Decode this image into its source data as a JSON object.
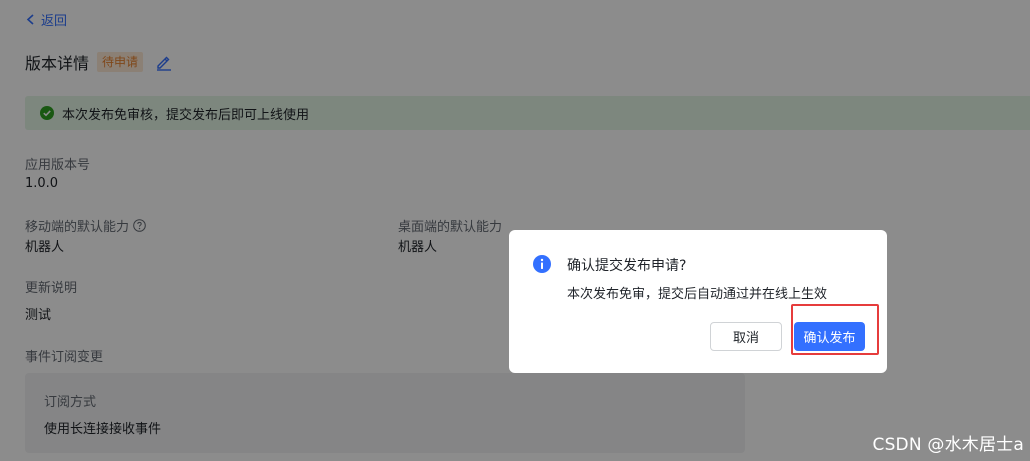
{
  "nav": {
    "back_label": "返回"
  },
  "header": {
    "title": "版本详情",
    "status": "待申请"
  },
  "notice": {
    "text": "本次发布免审核，提交发布后即可上线使用"
  },
  "fields": {
    "version": {
      "label": "应用版本号",
      "value": "1.0.0"
    },
    "mobile_capability": {
      "label": "移动端的默认能力",
      "value": "机器人"
    },
    "desktop_capability": {
      "label": "桌面端的默认能力",
      "value": "机器人"
    },
    "update_note": {
      "label": "更新说明",
      "value": "测试"
    },
    "event_change": {
      "label": "事件订阅变更"
    },
    "subscription_method": {
      "label": "订阅方式",
      "value": "使用长连接接收事件"
    }
  },
  "modal": {
    "title": "确认提交发布申请?",
    "description": "本次发布免审，提交后自动通过并在线上生效",
    "cancel_label": "取消",
    "confirm_label": "确认发布"
  },
  "watermark": "CSDN @水木居士a",
  "colors": {
    "primary": "#3370ff",
    "success": "#2ea121",
    "badge_text": "#e8822f",
    "badge_bg": "#fde9d6",
    "highlight": "#e63c3c"
  }
}
